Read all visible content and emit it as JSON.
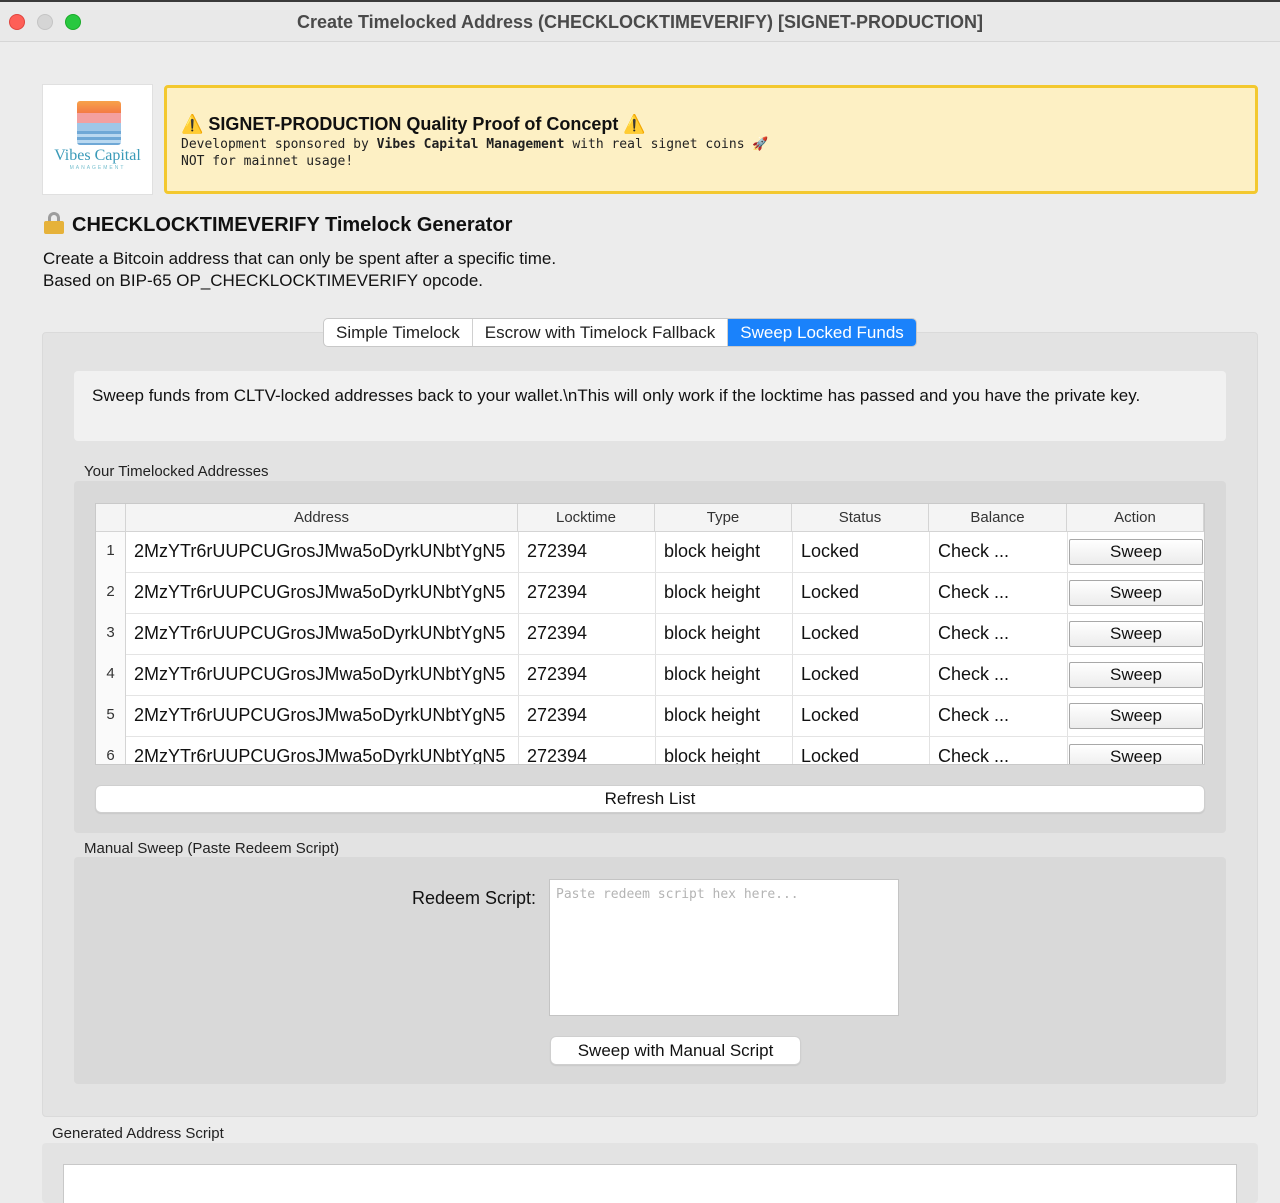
{
  "window": {
    "title": "Create Timelocked Address (CHECKLOCKTIMEVERIFY) [SIGNET-PRODUCTION]"
  },
  "logo": {
    "name": "Vibes Capital",
    "subtitle": "MANAGEMENT"
  },
  "banner": {
    "title": "⚠️ SIGNET-PRODUCTION Quality Proof of Concept ⚠️",
    "line1_prefix": "Development sponsored by ",
    "line1_bold": "Vibes Capital Management",
    "line1_suffix": " with real signet coins 🚀",
    "line2": "NOT for mainnet usage!",
    "background_color": "#fdf0c4",
    "border_color": "#f3c82e"
  },
  "header": {
    "icon": "lock-icon",
    "title": "CHECKLOCKTIMEVERIFY Timelock Generator",
    "desc1": "Create a Bitcoin address that can only be spent after a specific time.",
    "desc2": "Based on BIP-65 OP_CHECKLOCKTIMEVERIFY opcode."
  },
  "tabs": [
    {
      "label": "Simple Timelock",
      "active": false
    },
    {
      "label": "Escrow with Timelock Fallback",
      "active": false
    },
    {
      "label": "Sweep Locked Funds",
      "active": true
    }
  ],
  "accent_color": "#1a82fb",
  "sweep": {
    "info": "Sweep funds from CLTV-locked addresses back to your wallet.\\nThis will only work if the locktime has passed and you have the private key.",
    "addresses_group_label": "Your Timelocked Addresses",
    "table": {
      "columns": [
        "Address",
        "Locktime",
        "Type",
        "Status",
        "Balance",
        "Action"
      ],
      "rows": [
        {
          "num": "1",
          "address": "2MzYTr6rUUPCUGrosJMwa5oDyrkUNbtYgN5",
          "locktime": "272394",
          "type": "block height",
          "status": "Locked",
          "balance": "Check ...",
          "action": "Sweep"
        },
        {
          "num": "2",
          "address": "2MzYTr6rUUPCUGrosJMwa5oDyrkUNbtYgN5",
          "locktime": "272394",
          "type": "block height",
          "status": "Locked",
          "balance": "Check ...",
          "action": "Sweep"
        },
        {
          "num": "3",
          "address": "2MzYTr6rUUPCUGrosJMwa5oDyrkUNbtYgN5",
          "locktime": "272394",
          "type": "block height",
          "status": "Locked",
          "balance": "Check ...",
          "action": "Sweep"
        },
        {
          "num": "4",
          "address": "2MzYTr6rUUPCUGrosJMwa5oDyrkUNbtYgN5",
          "locktime": "272394",
          "type": "block height",
          "status": "Locked",
          "balance": "Check ...",
          "action": "Sweep"
        },
        {
          "num": "5",
          "address": "2MzYTr6rUUPCUGrosJMwa5oDyrkUNbtYgN5",
          "locktime": "272394",
          "type": "block height",
          "status": "Locked",
          "balance": "Check ...",
          "action": "Sweep"
        },
        {
          "num": "6",
          "address": "2MzYTr6rUUPCUGrosJMwa5oDyrkUNbtYgN5",
          "locktime": "272394",
          "type": "block height",
          "status": "Locked",
          "balance": "Check ...",
          "action": "Sweep"
        }
      ]
    },
    "refresh_label": "Refresh List",
    "manual_group_label": "Manual Sweep (Paste Redeem Script)",
    "redeem_label": "Redeem Script:",
    "redeem_value": "",
    "redeem_placeholder": "Paste redeem script hex here...",
    "manual_button": "Sweep with Manual Script"
  },
  "generated": {
    "label": "Generated Address  Script",
    "value": ""
  }
}
